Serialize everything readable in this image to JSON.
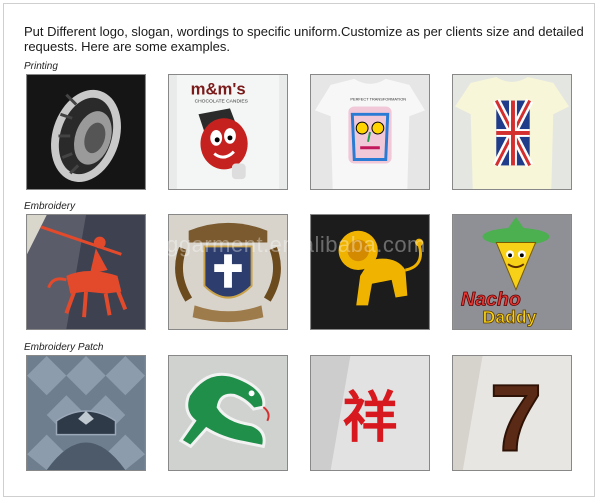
{
  "intro_text": "Put Different logo, slogan, wordings to specific uniform.Customize as per clients size and detailed requests. Here are some examples.",
  "sections": [
    {
      "label": "Printing"
    },
    {
      "label": "Embroidery"
    },
    {
      "label": "Embroidery Patch"
    }
  ],
  "images": {
    "mms_text": "m&m's",
    "mms_subtext": "CHOCOLATE CANDIES",
    "shirt_caption": "PERFECT TRANSFORMATION",
    "nacho_line1": "Nacho",
    "nacho_line2": "Daddy",
    "patch_number": "7",
    "chinese_char": "祥"
  },
  "watermark": "inggarment.en.alibaba.com"
}
